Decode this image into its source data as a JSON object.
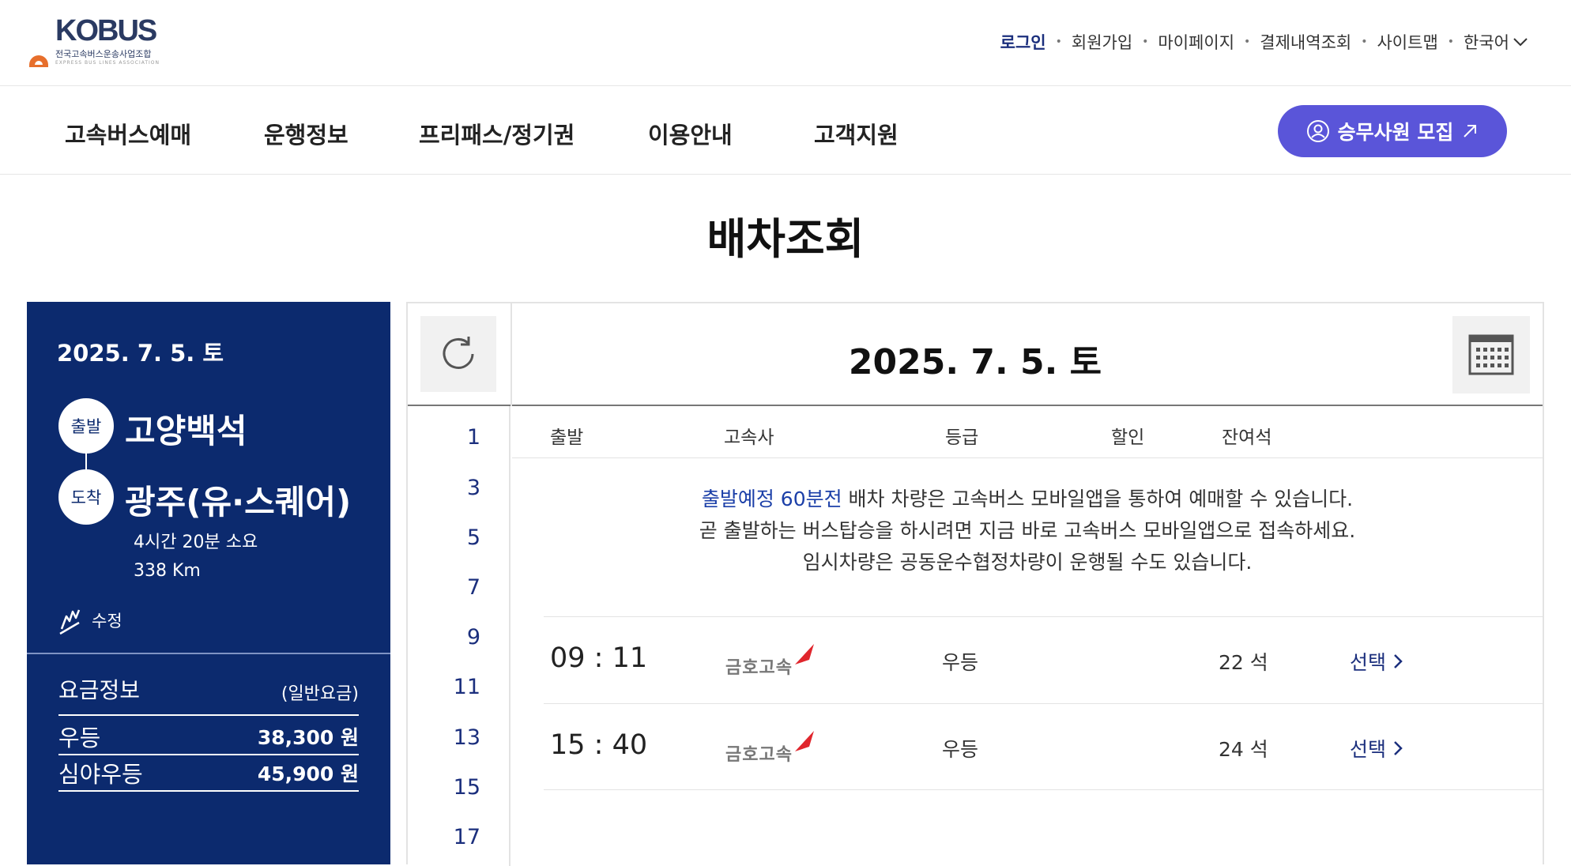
{
  "logo": {
    "text": "KOBUS",
    "subtitle": "전국고속버스운송사업조합",
    "subtitle_en": "EXPRESS BUS LINES ASSOCIATION"
  },
  "util_nav": {
    "login": "로그인",
    "join": "회원가입",
    "mypage": "마이페이지",
    "payment": "결제내역조회",
    "sitemap": "사이트맵",
    "language": "한국어"
  },
  "gnb": {
    "items": [
      "고속버스예매",
      "운행정보",
      "프리패스/정기권",
      "이용안내",
      "고객지원"
    ],
    "recruit": "승무사원 모집"
  },
  "page_title": "배차조회",
  "left_panel": {
    "date": "2025. 7. 5. 토",
    "departure_tag": "출발",
    "departure": "고양백석",
    "arrival_tag": "도착",
    "arrival": "광주(유·스퀘어)",
    "duration": "4시간 20분 소요",
    "distance": "338 Km",
    "edit": "수정",
    "fare_title": "요금정보",
    "fare_sub": "(일반요금)",
    "fares": [
      {
        "grade": "우등",
        "price": "38,300 원"
      },
      {
        "grade": "심야우등",
        "price": "45,900 원"
      }
    ]
  },
  "schedule": {
    "date": "2025. 7. 5. 토",
    "hours": [
      "1",
      "3",
      "5",
      "7",
      "9",
      "11",
      "13",
      "15",
      "17"
    ],
    "columns": {
      "departure": "출발",
      "company": "고속사",
      "grade": "등급",
      "discount": "할인",
      "seats": "잔여석"
    },
    "notice": {
      "highlight": "출발예정 60분전",
      "line1_rest": " 배차 차량은 고속버스 모바일앱을 통하여 예매할 수 있습니다.",
      "line2": "곧 출발하는 버스탑승을 하시려면 지금 바로 고속버스 모바일앱으로 접속하세요.",
      "line3": "임시차량은 공동운수협정차량이 운행될 수도 있습니다."
    },
    "rows": [
      {
        "time": "09 : 11",
        "company": "금호고속",
        "grade": "우등",
        "seats": "22 석",
        "select": "선택"
      },
      {
        "time": "15 : 40",
        "company": "금호고속",
        "grade": "우등",
        "seats": "24 석",
        "select": "선택"
      }
    ]
  },
  "colors": {
    "navy": "#0c2a6e",
    "accent_purple": "#5a55d9",
    "link_blue": "#1b2f7d",
    "kumho_red": "#e0262d"
  }
}
